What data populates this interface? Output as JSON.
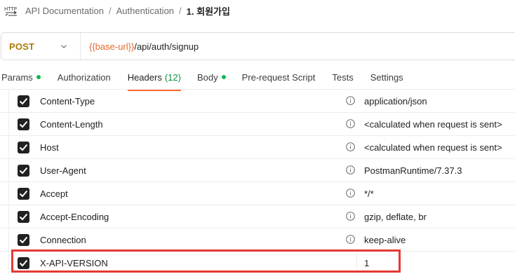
{
  "breadcrumb": {
    "icon": "http-icon",
    "items": [
      "API Documentation",
      "Authentication",
      "1. 회원가입"
    ],
    "separator": "/"
  },
  "request": {
    "method": "POST",
    "url_variable": "{{base-url}}",
    "url_path": "/api/auth/signup"
  },
  "tabs": [
    {
      "label": "Params",
      "dot": true
    },
    {
      "label": "Authorization"
    },
    {
      "label": "Headers",
      "count": "(12)",
      "active": true
    },
    {
      "label": "Body",
      "dot": true
    },
    {
      "label": "Pre-request Script"
    },
    {
      "label": "Tests"
    },
    {
      "label": "Settings"
    }
  ],
  "headers": [
    {
      "key": "Content-Type",
      "value": "application/json",
      "checked": true
    },
    {
      "key": "Content-Length",
      "value": "<calculated when request is sent>",
      "checked": true
    },
    {
      "key": "Host",
      "value": "<calculated when request is sent>",
      "checked": true
    },
    {
      "key": "User-Agent",
      "value": "PostmanRuntime/7.37.3",
      "checked": true
    },
    {
      "key": "Accept",
      "value": "*/*",
      "checked": true
    },
    {
      "key": "Accept-Encoding",
      "value": "gzip, deflate, br",
      "checked": true
    },
    {
      "key": "Connection",
      "value": "keep-alive",
      "checked": true
    },
    {
      "key": "X-API-VERSION",
      "value": "1",
      "checked": true
    }
  ],
  "colors": {
    "method": "#ad7a03",
    "url_variable": "#e8682c",
    "tab_active_underline": "#ff6c37",
    "status_dot": "#0cbb52",
    "highlight_border": "#e53935"
  }
}
